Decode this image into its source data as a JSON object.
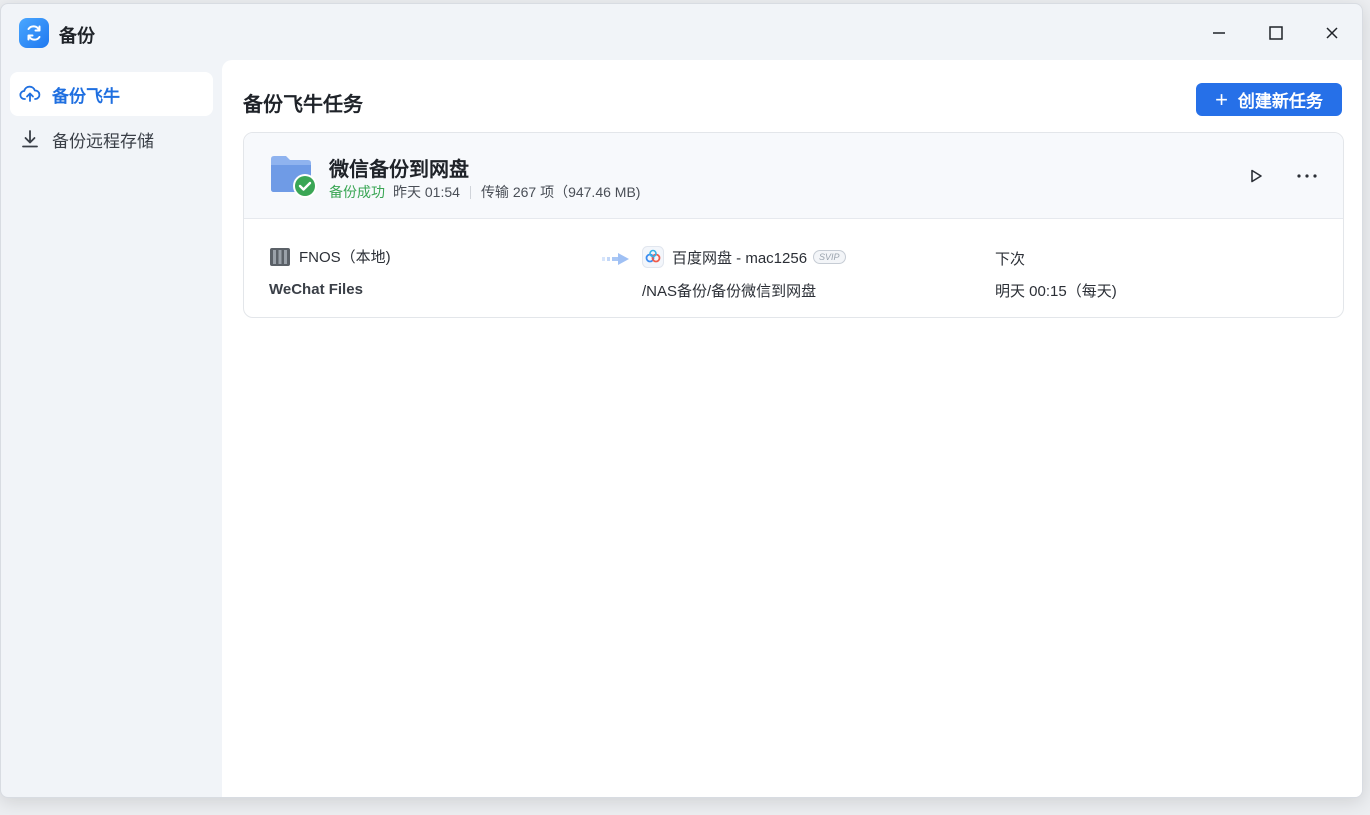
{
  "window": {
    "title": "备份",
    "minimize_icon": "minimize-icon",
    "maximize_icon": "maximize-icon",
    "close_icon": "close-icon"
  },
  "sidebar": {
    "items": [
      {
        "label": "备份飞牛",
        "icon": "cloud-upload-icon",
        "active": true
      },
      {
        "label": "备份远程存储",
        "icon": "download-icon",
        "active": false
      }
    ]
  },
  "main": {
    "title": "备份飞牛任务",
    "create_button_label": "创建新任务"
  },
  "task": {
    "name": "微信备份到网盘",
    "status": "备份成功",
    "last_time": "昨天 01:54",
    "transfer": "传输 267 项（947.46 MB)",
    "source_name": "FNOS（本地)",
    "source_path": "WeChat Files",
    "dest_name": "百度网盘 - mac1256",
    "dest_badge": "SVIP",
    "dest_path": "/NAS备份/备份微信到网盘",
    "next_label": "下次",
    "next_time": "明天 00:15（每天)"
  },
  "colors": {
    "accent": "#2670e8",
    "success": "#3aa655"
  }
}
